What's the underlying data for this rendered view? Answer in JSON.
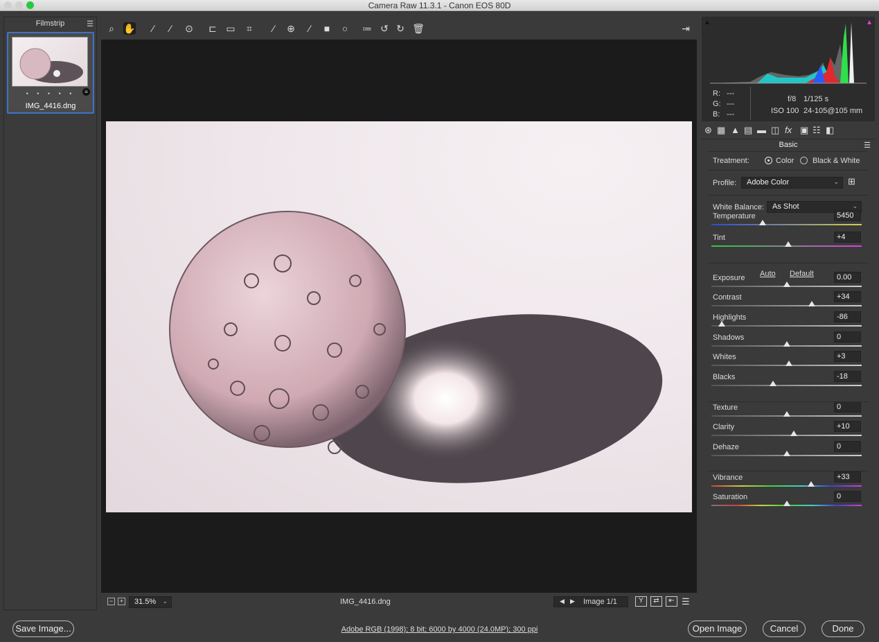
{
  "window": {
    "title": "Camera Raw 11.3.1  -  Canon EOS 80D"
  },
  "filmstrip": {
    "header": "Filmstrip",
    "menu_icon": "hamburger-icon",
    "items": [
      {
        "filename": "IMG_4416.dng",
        "rating_dots": "• • • • •",
        "selected": true
      }
    ]
  },
  "toolbar": {
    "tools": [
      "zoom-icon",
      "hand-icon",
      "white-balance-icon",
      "color-sampler-icon",
      "targeted-adjustment-icon",
      "crop-icon",
      "straighten-icon",
      "transform-icon",
      "spot-removal-icon",
      "red-eye-icon",
      "adjustment-brush-icon",
      "graduated-filter-icon",
      "radial-filter-icon",
      "preferences-icon",
      "rotate-left-icon",
      "rotate-right-icon",
      "trash-icon"
    ],
    "fullscreen_icon": "fullscreen-icon"
  },
  "preview": {
    "zoom_label": "31.5%",
    "filename": "IMG_4416.dng",
    "image_counter": "Image 1/1"
  },
  "histogram": {
    "r_label": "R:",
    "r_value": "---",
    "g_label": "G:",
    "g_value": "---",
    "b_label": "B:",
    "b_value": "---",
    "aperture": "f/8",
    "shutter": "1/125 s",
    "iso": "ISO 100",
    "lens": "24-105@105 mm"
  },
  "panel": {
    "title": "Basic",
    "treatment_label": "Treatment:",
    "treatment_options": [
      "Color",
      "Black & White"
    ],
    "treatment_selected": "Color",
    "profile_label": "Profile:",
    "profile_value": "Adobe Color",
    "wb_label": "White Balance:",
    "wb_value": "As Shot",
    "auto_label": "Auto",
    "default_label": "Default",
    "sliders": [
      {
        "name": "Temperature",
        "value": "5450",
        "pos": 0.34
      },
      {
        "name": "Tint",
        "value": "+4",
        "pos": 0.51
      },
      {
        "name": "Exposure",
        "value": "0.00",
        "pos": 0.5
      },
      {
        "name": "Contrast",
        "value": "+34",
        "pos": 0.67
      },
      {
        "name": "Highlights",
        "value": "-86",
        "pos": 0.07
      },
      {
        "name": "Shadows",
        "value": "0",
        "pos": 0.5
      },
      {
        "name": "Whites",
        "value": "+3",
        "pos": 0.515
      },
      {
        "name": "Blacks",
        "value": "-18",
        "pos": 0.41
      },
      {
        "name": "Texture",
        "value": "0",
        "pos": 0.5
      },
      {
        "name": "Clarity",
        "value": "+10",
        "pos": 0.55
      },
      {
        "name": "Dehaze",
        "value": "0",
        "pos": 0.5
      },
      {
        "name": "Vibrance",
        "value": "+33",
        "pos": 0.665
      },
      {
        "name": "Saturation",
        "value": "0",
        "pos": 0.5
      }
    ]
  },
  "footer": {
    "save_label": "Save Image...",
    "metadata_link": "Adobe RGB (1998); 8 bit; 6000 by 4000 (24.0MP); 300 ppi",
    "open_label": "Open Image",
    "cancel_label": "Cancel",
    "done_label": "Done"
  },
  "colors": {
    "accent": "#3d74c9",
    "panel_bg": "#3a3a3a",
    "preview_bg": "#1b1b1b"
  }
}
